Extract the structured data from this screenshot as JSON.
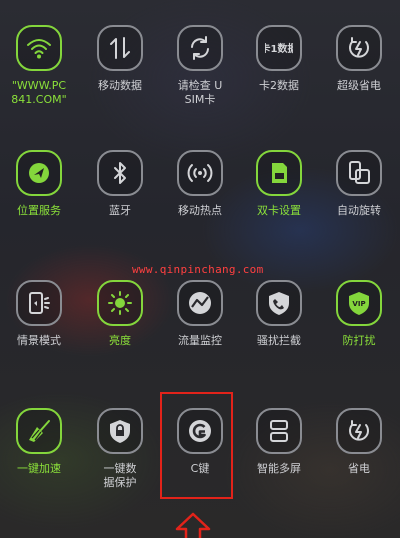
{
  "colors": {
    "active": "#84d63c",
    "inactive": "#8a8c92",
    "highlight": "#e2231a",
    "watermark": "#ff4040"
  },
  "rows": [
    [
      {
        "label": "\"WWW.PC\n841.COM\"",
        "icon": "wifi-icon",
        "on": true
      },
      {
        "label": "移动数据",
        "icon": "mobile-data-icon",
        "on": false
      },
      {
        "label": "请检查 U\nSIM卡",
        "icon": "sync-icon",
        "on": false
      },
      {
        "label": "卡2数据",
        "icon": "card1-data-icon",
        "icon_text": "卡1数据",
        "on": false
      },
      {
        "label": "超级省电",
        "icon": "super-power-save-icon",
        "on": false
      }
    ],
    [
      {
        "label": "位置服务",
        "icon": "location-icon",
        "on": true
      },
      {
        "label": "蓝牙",
        "icon": "bluetooth-icon",
        "on": false
      },
      {
        "label": "移动热点",
        "icon": "hotspot-icon",
        "on": false
      },
      {
        "label": "双卡设置",
        "icon": "dual-sim-icon",
        "on": true
      },
      {
        "label": "自动旋转",
        "icon": "auto-rotate-icon",
        "on": false
      }
    ],
    [
      {
        "label": "情景模式",
        "icon": "scene-mode-icon",
        "on": false
      },
      {
        "label": "亮度",
        "icon": "brightness-icon",
        "on": true
      },
      {
        "label": "流量监控",
        "icon": "traffic-monitor-icon",
        "on": false
      },
      {
        "label": "骚扰拦截",
        "icon": "harassment-block-icon",
        "on": false
      },
      {
        "label": "防打扰",
        "icon": "vip-icon",
        "icon_text": "VIP",
        "on": true
      }
    ],
    [
      {
        "label": "一键加速",
        "icon": "broom-icon",
        "on": true
      },
      {
        "label": "一键数\n据保护",
        "icon": "lock-shield-icon",
        "on": false
      },
      {
        "label": "C键",
        "icon": "c-key-icon",
        "on": false
      },
      {
        "label": "智能多屏",
        "icon": "multi-screen-icon",
        "on": false
      },
      {
        "label": "省电",
        "icon": "power-save-icon",
        "on": false
      }
    ]
  ],
  "watermark": "www.qinpinchang.com"
}
